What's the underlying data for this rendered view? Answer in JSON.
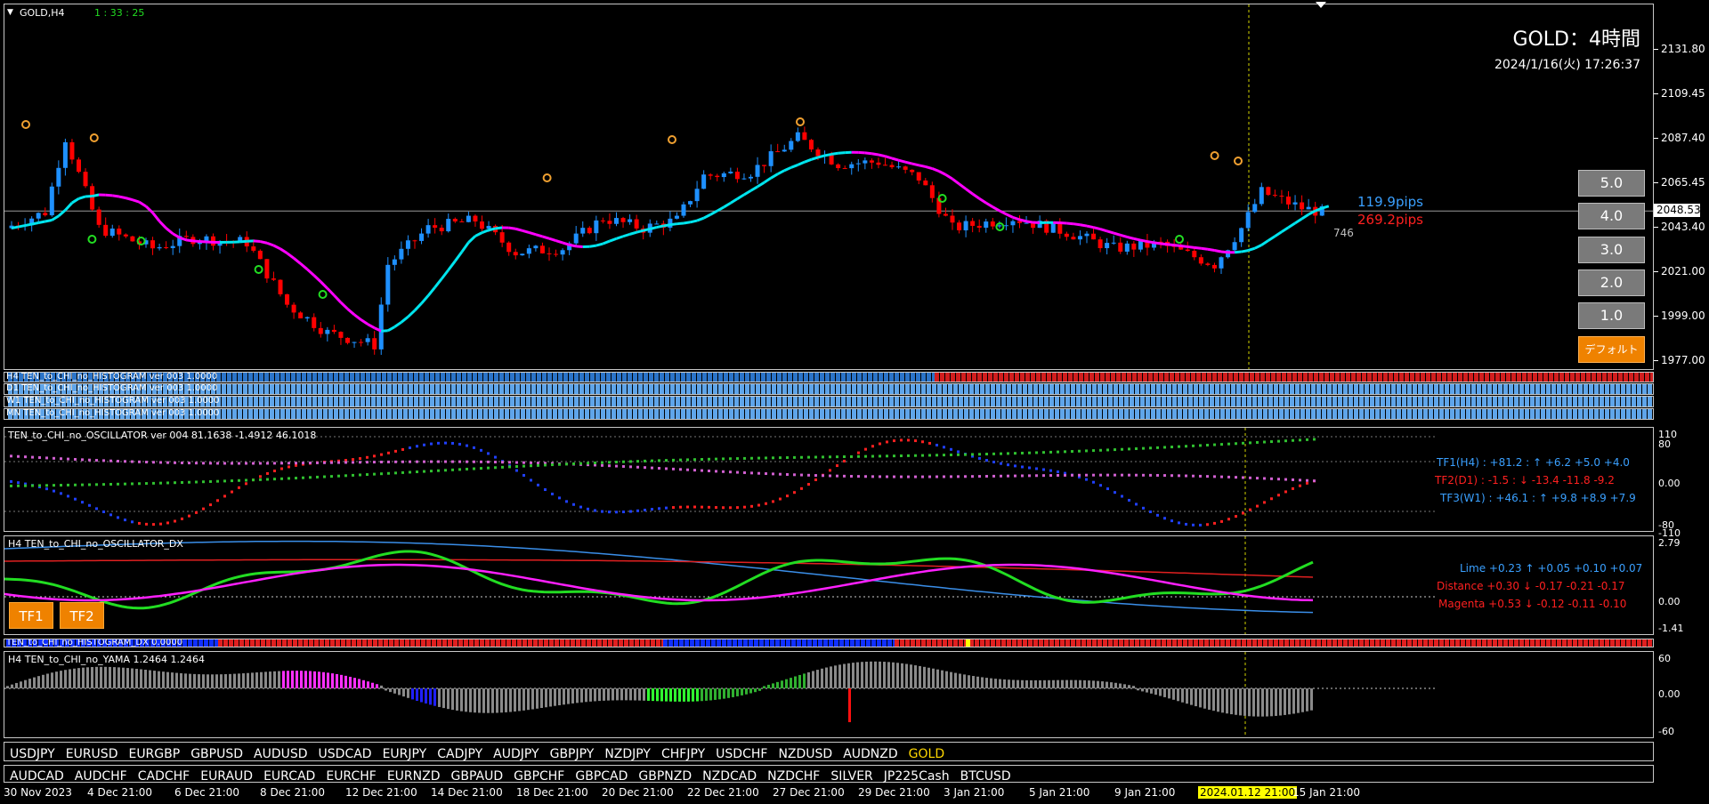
{
  "chart": {
    "symbol_label": "GOLD,H4",
    "timer": "1 : 33 : 25",
    "title": "GOLD：4時間",
    "datetime": "2024/1/16(火) 17:26:37",
    "current_price": "2048.53",
    "pips_up": "119.9pips",
    "pips_down": "269.2pips",
    "spread_count": "746",
    "price_ticks": [
      "2131.80",
      "2109.45",
      "2087.40",
      "2065.45",
      "2043.40",
      "2021.00",
      "1999.00",
      "1977.00"
    ]
  },
  "side_buttons": [
    "5.0",
    "4.0",
    "3.0",
    "2.0",
    "1.0",
    "デフォルト"
  ],
  "histogram_bars": [
    "H4 TEN_to_CHI_no_HISTOGRAM ver 003 1.0000",
    "D1 TEN_to_CHI_no_HISTOGRAM ver 003 1.0000",
    "W1 TEN_to_CHI_no_HISTOGRAM ver 003 1.0000",
    "MN TEN_to_CHI_no_HISTOGRAM ver 003 1.0000"
  ],
  "oscillator": {
    "label": "TEN_to_CHI_no_OSCILLATOR ver 004 81.1638 -1.4912 46.1018",
    "ticks": [
      "110",
      "80",
      "0.00",
      "-80",
      "-110"
    ],
    "tf1": "TF1(H4) : +81.2 : ↑ +6.2 +5.0 +4.0",
    "tf2": "TF2(D1) : -1.5 : ↓ -13.4 -11.8 -9.2",
    "tf3": "TF3(W1) : +46.1 : ↑ +9.8 +8.9 +7.9"
  },
  "dx": {
    "label": "H4 TEN_to_CHI_no_OSCILLATOR_DX",
    "ticks": [
      "2.79",
      "0.00",
      "-1.41"
    ],
    "lime": "Lime +0.23 ↑ +0.05 +0.10 +0.07",
    "distance": "Distance +0.30 ↓ -0.17 -0.21 -0.17",
    "magenta": "Magenta +0.53 ↓ -0.12 -0.11 -0.10",
    "tf1_button": "TF1",
    "tf2_button": "TF2"
  },
  "hist_dx_label": "TEN_to_CHI_no_HISTOGRAM_DX 0.0000",
  "yama": {
    "label": "H4 TEN_to_CHI_no_YAMA 1.2464 1.2464",
    "ticks": [
      "60",
      "0.00",
      "-60"
    ]
  },
  "symbols_row1": [
    "USDJPY",
    "EURUSD",
    "EURGBP",
    "GBPUSD",
    "AUDUSD",
    "USDCAD",
    "EURJPY",
    "CADJPY",
    "AUDJPY",
    "GBPJPY",
    "NZDJPY",
    "CHFJPY",
    "USDCHF",
    "NZDUSD",
    "AUDNZD",
    "GOLD"
  ],
  "symbols_row2": [
    "AUDCAD",
    "AUDCHF",
    "CADCHF",
    "EURAUD",
    "EURCAD",
    "EURCHF",
    "EURNZD",
    "GBPAUD",
    "GBPCHF",
    "GBPCAD",
    "GBPNZD",
    "NZDCAD",
    "NZDCHF",
    "SILVER",
    "JP225Cash",
    "BTCUSD"
  ],
  "time_labels": [
    "30 Nov 2023",
    "4 Dec 21:00",
    "6 Dec 21:00",
    "8 Dec 21:00",
    "12 Dec 21:00",
    "14 Dec 21:00",
    "18 Dec 21:00",
    "20 Dec 21:00",
    "22 Dec 21:00",
    "27 Dec 21:00",
    "29 Dec 21:00",
    "3 Jan 21:00",
    "5 Jan 21:00",
    "9 Jan 21:00",
    "2024.01.12 21:00",
    "15 Jan 21:00"
  ],
  "colors": {
    "bull": "#1e90ff",
    "bear": "#ff0000",
    "ma_up": "#00e5ee",
    "ma_down": "#ff00ff",
    "accent": "#ef8200",
    "gold_symbol": "#ffd700",
    "crosshair": "#d4d400"
  }
}
